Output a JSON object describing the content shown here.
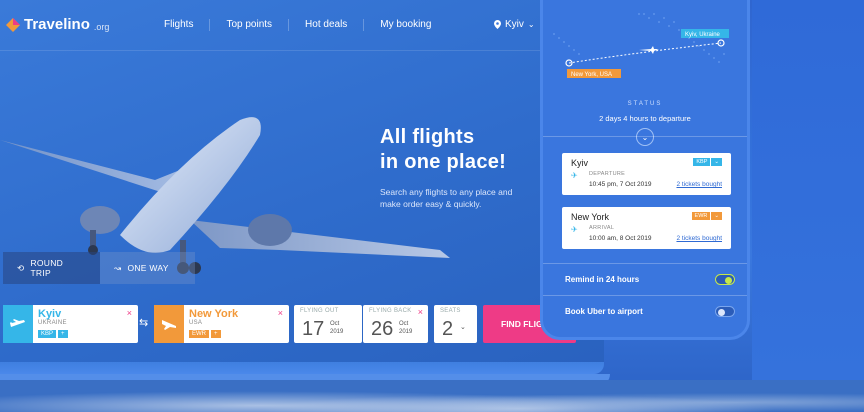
{
  "brand": {
    "name": "Travelino",
    "suffix": ".org"
  },
  "nav": {
    "items": [
      "Flights",
      "Top points",
      "Hot deals",
      "My booking"
    ]
  },
  "location": {
    "selected": "Kyiv"
  },
  "hero": {
    "title_line1": "All flights",
    "title_line2": "in one place!",
    "subtitle": "Search any flights to any place and make order easy & quickly."
  },
  "trip_tabs": [
    {
      "label": "ROUND TRIP",
      "active": true
    },
    {
      "label": "ONE WAY",
      "active": false
    }
  ],
  "search": {
    "from": {
      "city": "Kyiv",
      "country": "UKRAINE",
      "code": "KBP",
      "color": "#35b6e8"
    },
    "to": {
      "city": "New York",
      "country": "USA",
      "code": "EWR",
      "color": "#f2993a"
    },
    "flying_out": {
      "label": "FLYING OUT",
      "day": "17",
      "month": "Oct",
      "year": "2019"
    },
    "flying_back": {
      "label": "FLYING BACK",
      "day": "26",
      "month": "Oct",
      "year": "2019"
    },
    "seats": {
      "label": "SEATS",
      "value": "2"
    },
    "find_label": "FIND FLIG"
  },
  "phone": {
    "map": {
      "origin_label": "Kyiv, Ukraine",
      "dest_label": "New York, USA"
    },
    "status_label": "STATUS",
    "status_text": "2 days 4 hours to departure",
    "departure": {
      "city": "Kyiv",
      "code": "KBP",
      "kind": "DEPARTURE",
      "time": "10:45 pm, 7 Oct 2019",
      "link": "2 tickets bought"
    },
    "arrival": {
      "city": "New York",
      "code": "EWR",
      "kind": "ARRIVAL",
      "time": "10:00 am, 8 Oct 2019",
      "link": "2 tickets bought"
    },
    "toggles": [
      {
        "label": "Remind in 24 hours",
        "on": true
      },
      {
        "label": "Book Uber to airport",
        "on": false
      }
    ]
  },
  "colors": {
    "accent_blue": "#35b6e8",
    "accent_orange": "#f2993a",
    "accent_pink": "#ee3b86",
    "toggle_on": "#c6e84a"
  }
}
